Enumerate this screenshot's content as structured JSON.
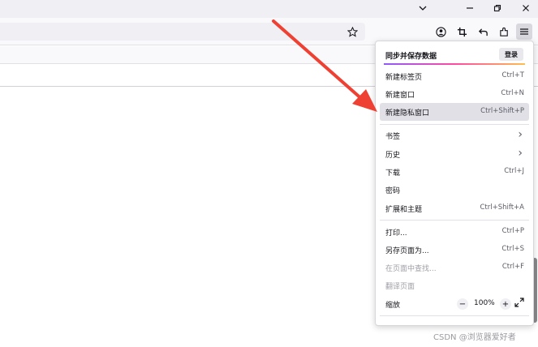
{
  "window": {
    "chevron_icon": "chevron-down-icon",
    "minimize_icon": "minimize-icon",
    "restore_icon": "restore-icon",
    "close_icon": "close-icon"
  },
  "toolbar": {
    "star_icon": "bookmark-star-icon",
    "account_icon": "account-icon",
    "crop_icon": "screenshot-icon",
    "back_icon": "undo-icon",
    "extensions_icon": "extensions-icon",
    "menu_icon": "hamburger-menu-icon"
  },
  "menu": {
    "sync_label": "同步并保存数据",
    "signin_label": "登录",
    "items": [
      {
        "label": "新建标签页",
        "shortcut": "Ctrl+T"
      },
      {
        "label": "新建窗口",
        "shortcut": "Ctrl+N"
      },
      {
        "label": "新建隐私窗口",
        "shortcut": "Ctrl+Shift+P"
      },
      {
        "label": "书签",
        "shortcut": ""
      },
      {
        "label": "历史",
        "shortcut": ""
      },
      {
        "label": "下载",
        "shortcut": "Ctrl+J"
      },
      {
        "label": "密码",
        "shortcut": ""
      },
      {
        "label": "扩展和主题",
        "shortcut": "Ctrl+Shift+A"
      },
      {
        "label": "打印...",
        "shortcut": "Ctrl+P"
      },
      {
        "label": "另存页面为...",
        "shortcut": "Ctrl+S"
      },
      {
        "label": "在页面中查找...",
        "shortcut": "Ctrl+F"
      },
      {
        "label": "翻译页面",
        "shortcut": ""
      },
      {
        "label": "缩放",
        "shortcut": ""
      }
    ],
    "zoom": {
      "minus": "−",
      "value": "100%",
      "plus": "+",
      "fullscreen_icon": "fullscreen-icon"
    }
  },
  "watermark": "CSDN @浏览器爱好者",
  "colors": {
    "arrow": "#ef4133",
    "highlight": "#e0e0e6"
  }
}
